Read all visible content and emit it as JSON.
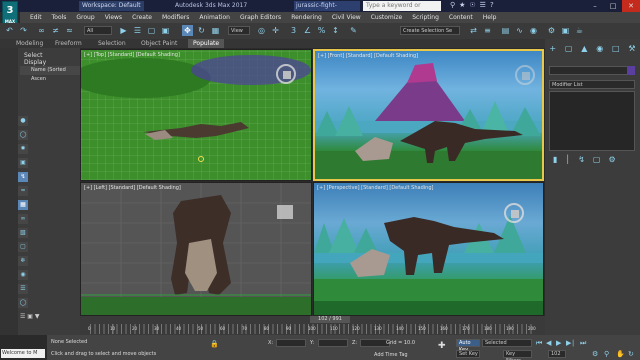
{
  "window": {
    "workspace": "Workspace: Default",
    "app_title": "Autodesk 3ds Max 2017",
    "file_name": "jurassic-fight-backup.max",
    "search_placeholder": "Type a keyword or phrase",
    "logo_text": "3",
    "logo_sub": "MAX"
  },
  "menu": [
    "Edit",
    "Tools",
    "Group",
    "Views",
    "Create",
    "Modifiers",
    "Animation",
    "Graph Editors",
    "Rendering",
    "Civil View",
    "Customize",
    "Scripting",
    "Content",
    "Help"
  ],
  "toolbar": {
    "selection_filter": "All",
    "view_dropdown": "View",
    "named_selection": "Create Selection Se"
  },
  "ribbon_tabs": [
    "Modeling",
    "Freeform",
    "Selection",
    "Object Paint",
    "Populate"
  ],
  "ribbon_active": "Populate",
  "explorer": {
    "tabs": [
      "Select",
      "Display"
    ],
    "column_header": "Name (Sorted Ascen"
  },
  "viewports": {
    "top": "[+] [Top] [Standard] [Default Shading]",
    "front": "[+] [Front] [Standard] [Default Shading]",
    "left": "[+] [Left] [Standard] [Default Shading]",
    "perspective": "[+] [Perspective] [Standard] [Default Shading]"
  },
  "command_panel": {
    "modifier_list": "Modifier List"
  },
  "timeline": {
    "frame_display": "102 / 991",
    "tick_labels": [
      "0",
      "10",
      "20",
      "30",
      "40",
      "50",
      "60",
      "70",
      "80",
      "90",
      "100",
      "110",
      "120",
      "130",
      "140",
      "150",
      "160",
      "170",
      "180",
      "190",
      "200"
    ]
  },
  "status": {
    "maxscript_text": "Welcome to M",
    "selection": "None Selected",
    "hint": "Click and drag to select and move objects",
    "x_label": "X:",
    "y_label": "Y:",
    "z_label": "Z:",
    "grid": "Grid = 10.0",
    "add_time_tag": "Add Time Tag",
    "auto_key": "Auto Key",
    "set_key": "Set Key",
    "selected": "Selected",
    "key_filters": "Key Filters...",
    "frame": "102"
  }
}
